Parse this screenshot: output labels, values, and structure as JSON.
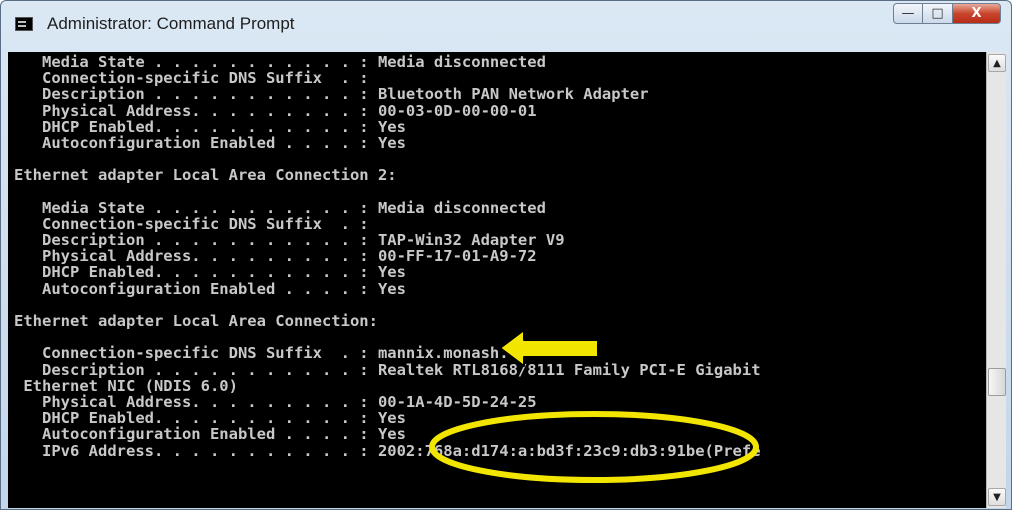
{
  "window": {
    "title": "Administrator: Command Prompt",
    "controls": {
      "minimize": "—",
      "maximize": "□",
      "close": "X"
    }
  },
  "console": {
    "lines": [
      "   Media State . . . . . . . . . . . : Media disconnected",
      "   Connection-specific DNS Suffix  . :",
      "   Description . . . . . . . . . . . : Bluetooth PAN Network Adapter",
      "   Physical Address. . . . . . . . . : 00-03-0D-00-00-01",
      "   DHCP Enabled. . . . . . . . . . . : Yes",
      "   Autoconfiguration Enabled . . . . : Yes",
      "",
      "Ethernet adapter Local Area Connection 2:",
      "",
      "   Media State . . . . . . . . . . . : Media disconnected",
      "   Connection-specific DNS Suffix  . :",
      "   Description . . . . . . . . . . . : TAP-Win32 Adapter V9",
      "   Physical Address. . . . . . . . . : 00-FF-17-01-A9-72",
      "   DHCP Enabled. . . . . . . . . . . : Yes",
      "   Autoconfiguration Enabled . . . . : Yes",
      "",
      "Ethernet adapter Local Area Connection:",
      "",
      "   Connection-specific DNS Suffix  . : mannix.monash.edu.au",
      "   Description . . . . . . . . . . . : Realtek RTL8168/8111 Family PCI-E Gigabit",
      " Ethernet NIC (NDIS 6.0)",
      "   Physical Address. . . . . . . . . : 00-1A-4D-5D-24-25",
      "   DHCP Enabled. . . . . . . . . . . : Yes",
      "   Autoconfiguration Enabled . . . . : Yes",
      "   IPv6 Address. . . . . . . . . . . : 2002:768a:d174:a:bd3f:23c9:db3:91be(Prefe"
    ]
  },
  "annotations": {
    "arrow_color": "#f2e600",
    "ellipse_color": "#f2e600"
  },
  "scrollbar": {
    "up_icon": "▲",
    "down_icon": "▼"
  }
}
